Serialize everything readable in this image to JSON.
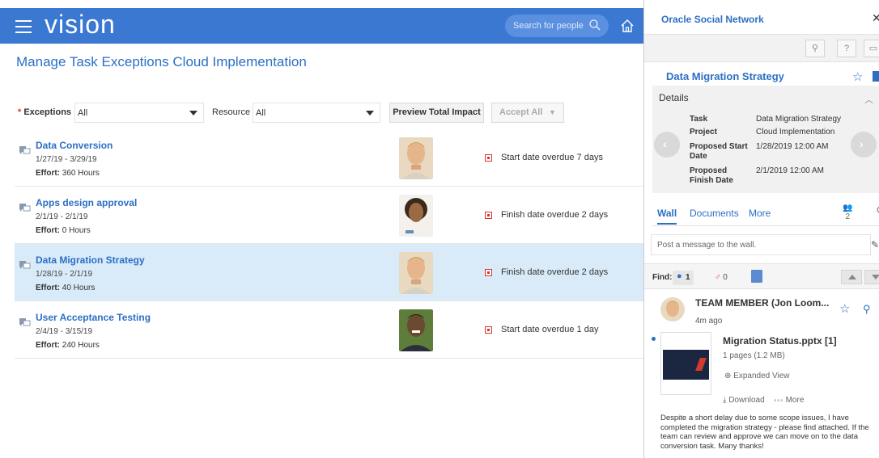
{
  "app": {
    "brand": "vision",
    "search_placeholder": "Search for people",
    "page_title": "Manage Task Exceptions  Cloud Implementation"
  },
  "filters": {
    "exceptions_label": "Exceptions",
    "exceptions_value": "All",
    "resource_label": "Resource",
    "resource_value": "All",
    "preview_label": "Preview Total Impact",
    "accept_label": "Accept All"
  },
  "tasks": [
    {
      "title": "Data Conversion",
      "dates": "1/27/19 - 3/29/19",
      "effort_label": "Effort:",
      "effort": "360 Hours",
      "status": "Start date overdue 7 days",
      "selected": false
    },
    {
      "title": "Apps design approval",
      "dates": "2/1/19 - 2/1/19",
      "effort_label": "Effort:",
      "effort": "0 Hours",
      "status": "Finish date overdue 2 days",
      "selected": false
    },
    {
      "title": "Data Migration Strategy",
      "dates": "1/28/19 - 2/1/19",
      "effort_label": "Effort:",
      "effort": "40 Hours",
      "status": "Finish date overdue 2 days",
      "selected": true
    },
    {
      "title": "User Acceptance Testing",
      "dates": "2/4/19 - 3/15/19",
      "effort_label": "Effort:",
      "effort": "240 Hours",
      "status": "Start date overdue 1 day",
      "selected": false
    }
  ],
  "side": {
    "title": "Oracle Social Network",
    "object_title": "Data Migration Strategy",
    "details_label": "Details",
    "details": [
      {
        "label": "Task",
        "value": "Data Migration Strategy"
      },
      {
        "label": "Project",
        "value": "Cloud Implementation"
      },
      {
        "label": "Proposed Start Date",
        "value": "1/28/2019 12:00 AM"
      },
      {
        "label": "Proposed Finish Date",
        "value": "2/1/2019 12:00 AM"
      }
    ],
    "tabs": [
      "Wall",
      "Documents",
      "More"
    ],
    "members_count": "2",
    "post_placeholder": "Post a message to the wall.",
    "find_label": "Find:",
    "find_count_a": "1",
    "find_count_b": "0",
    "feed": {
      "author": "TEAM MEMBER (Jon Loom...",
      "time": "4m ago",
      "file_name": "Migration Status.pptx [1]",
      "file_meta": "1 pages (1.2 MB)",
      "expanded_view": "Expanded View",
      "download": "Download",
      "more": "More",
      "message": "Despite a short delay due to some scope issues, I have completed the migration strategy - please find attached. If the team can review and approve we can move on to the data conversion task.  Many thanks!"
    }
  },
  "colors": {
    "topbar": "#3a78d1",
    "link": "#2c6fc4",
    "selected_row": "#d9ebf9",
    "alert": "#dd3333"
  }
}
